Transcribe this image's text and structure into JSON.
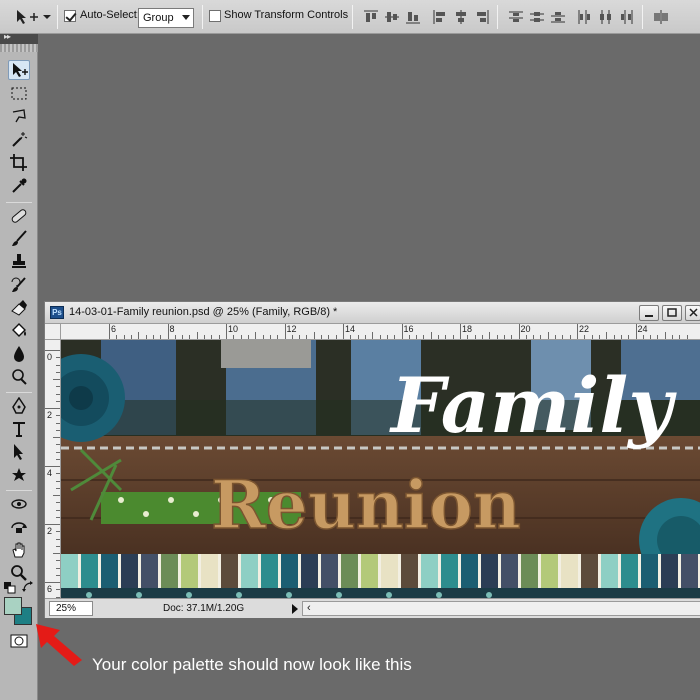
{
  "options_bar": {
    "auto_select_label": "Auto-Select:",
    "auto_select_checked": true,
    "auto_select_target": "Group",
    "show_transform_label": "Show Transform Controls",
    "show_transform_checked": false
  },
  "document": {
    "title": "14-03-01-Family reunion.psd @ 25% (Family, RGB/8) *",
    "ruler_h_labels": [
      "6",
      "8",
      "10",
      "12",
      "14",
      "16",
      "18",
      "20",
      "22",
      "24"
    ],
    "ruler_v_labels": [
      "0",
      "2",
      "4",
      "2",
      "6"
    ],
    "artwork_line1": "Family",
    "artwork_line2": "Reunion",
    "zoom": "25%",
    "doc_size": "Doc: 37.1M/1.20G"
  },
  "swatches": {
    "foreground": "#a9d2c2",
    "background": "#1e7f84"
  },
  "palette_colors": [
    "#8ecfc4",
    "#2d8d8e",
    "#1b5e72",
    "#2c3e55",
    "#445067",
    "#6c8c57",
    "#b3c979",
    "#e8e2c4",
    "#5c4b3b"
  ],
  "caption": "Your color palette should now look like this",
  "colors": {
    "annotation_arrow": "#e41b17",
    "wood": "#5b3f2c",
    "cork": "#c79a62"
  }
}
